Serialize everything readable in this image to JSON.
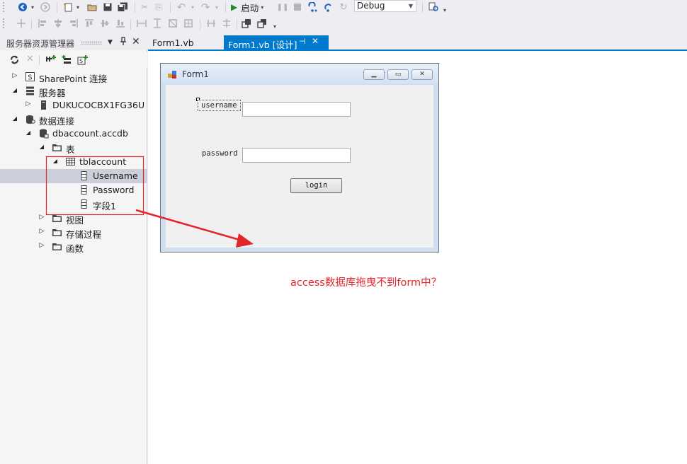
{
  "toolbar": {
    "start_label": "启动",
    "config_value": "Debug"
  },
  "server_explorer": {
    "title": "服务器资源管理器",
    "tree": [
      {
        "label": "SharePoint 连接",
        "icon": "sharepoint-icon",
        "expander": "collapsed",
        "indent": 0
      },
      {
        "label": "服务器",
        "icon": "servers-icon",
        "expander": "expanded",
        "indent": 0
      },
      {
        "label": "DUKUCOCBX1FG36U",
        "icon": "computer-icon",
        "expander": "collapsed",
        "indent": 1
      },
      {
        "label": "数据连接",
        "icon": "data-connections-icon",
        "expander": "expanded",
        "indent": 0
      },
      {
        "label": "dbaccount.accdb",
        "icon": "database-icon",
        "expander": "expanded",
        "indent": 1
      },
      {
        "label": "表",
        "icon": "folder-icon",
        "expander": "expanded",
        "indent": 2
      },
      {
        "label": "tblaccount",
        "icon": "table-icon",
        "expander": "expanded",
        "indent": 3
      },
      {
        "label": "Username",
        "icon": "column-icon",
        "expander": "none",
        "indent": 4,
        "selected": true
      },
      {
        "label": "Password",
        "icon": "column-icon",
        "expander": "none",
        "indent": 4
      },
      {
        "label": "字段1",
        "icon": "column-icon",
        "expander": "none",
        "indent": 4
      },
      {
        "label": "视图",
        "icon": "folder-icon",
        "expander": "collapsed",
        "indent": 2
      },
      {
        "label": "存储过程",
        "icon": "folder-icon",
        "expander": "collapsed",
        "indent": 2
      },
      {
        "label": "函数",
        "icon": "folder-icon",
        "expander": "collapsed",
        "indent": 2
      }
    ]
  },
  "tabs": [
    {
      "label": "Form1.vb",
      "active": false
    },
    {
      "label": "Form1.vb [设计]",
      "active": true
    }
  ],
  "form": {
    "title": "Form1",
    "username_label": "username",
    "password_label": "password",
    "username_value": "",
    "password_value": "",
    "login_button": "login"
  },
  "annotation": {
    "text": "access数据库拖曳不到form中？",
    "color": "#e3262c"
  },
  "colors": {
    "accent": "#007acc",
    "selection": "#ccced9",
    "annotation_red": "#e3262c"
  }
}
